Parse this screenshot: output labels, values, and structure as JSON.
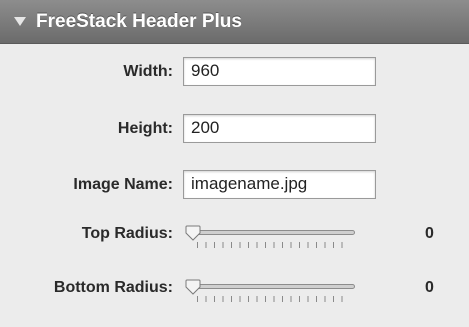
{
  "panel": {
    "title": "FreeStack Header Plus"
  },
  "fields": {
    "width_label": "Width:",
    "width_value": "960",
    "height_label": "Height:",
    "height_value": "200",
    "image_name_label": "Image Name:",
    "image_name_value": "imagename.jpg"
  },
  "sliders": {
    "top_radius_label": "Top Radius:",
    "top_radius_value": "0",
    "top_radius_fraction": 0,
    "bottom_radius_label": "Bottom Radius:",
    "bottom_radius_value": "0",
    "bottom_radius_fraction": 0
  },
  "icons": {
    "disclosure": "disclosure-triangle-icon",
    "slider_thumb": "slider-thumb-icon"
  },
  "colors": {
    "header_bg": "#7b7b7b",
    "panel_bg": "#ececec"
  }
}
